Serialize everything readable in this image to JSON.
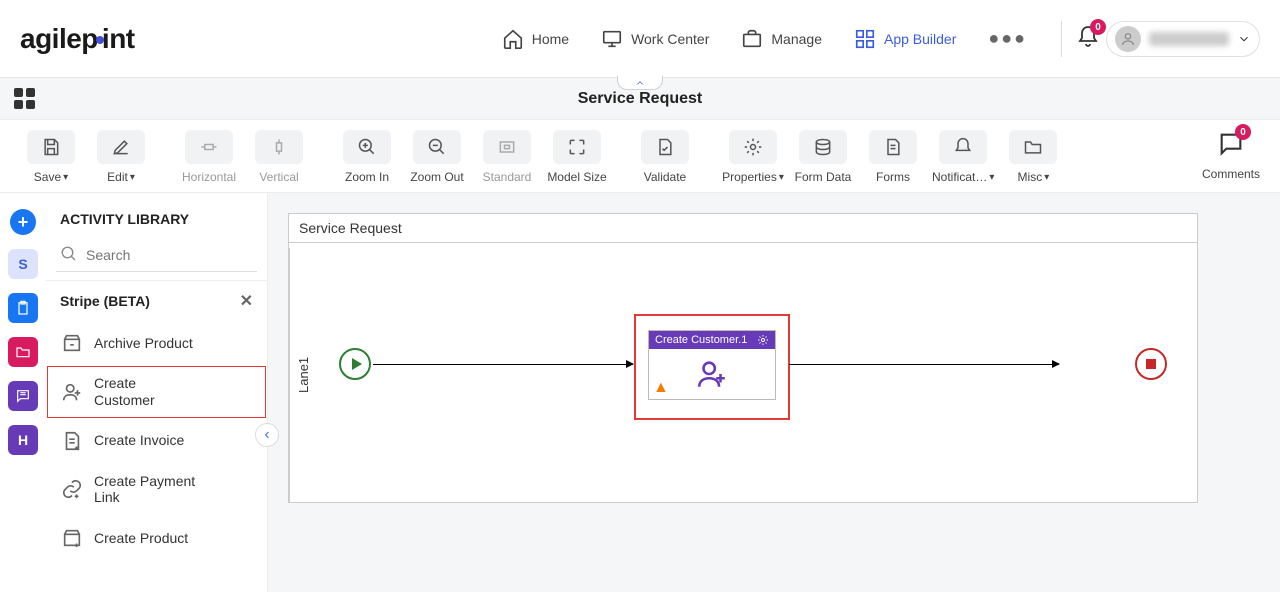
{
  "topnav": {
    "logo_text_1": "agilep",
    "logo_text_2": "int",
    "items": [
      {
        "label": "Home"
      },
      {
        "label": "Work Center"
      },
      {
        "label": "Manage"
      },
      {
        "label": "App Builder"
      }
    ],
    "notification_count": "0"
  },
  "breadcrumb": {
    "title": "Service Request"
  },
  "toolbar": {
    "save": "Save",
    "edit": "Edit",
    "horizontal": "Horizontal",
    "vertical": "Vertical",
    "zoom_in": "Zoom In",
    "zoom_out": "Zoom Out",
    "standard": "Standard",
    "model_size": "Model Size",
    "validate": "Validate",
    "properties": "Properties",
    "form_data": "Form Data",
    "forms": "Forms",
    "notifications": "Notificat…",
    "misc": "Misc",
    "comments": "Comments",
    "comments_badge": "0"
  },
  "rail": {
    "s_label": "S",
    "h_label": "H"
  },
  "sidepanel": {
    "title": "ACTIVITY LIBRARY",
    "search_placeholder": "Search",
    "group": "Stripe (BETA)",
    "items": [
      "Archive Product",
      "Create Customer",
      "Create Invoice",
      "Create Payment Link",
      "Create Product"
    ]
  },
  "canvas": {
    "process_title": "Service Request",
    "lane": "Lane1",
    "activity": {
      "title": "Create Customer.1"
    }
  }
}
